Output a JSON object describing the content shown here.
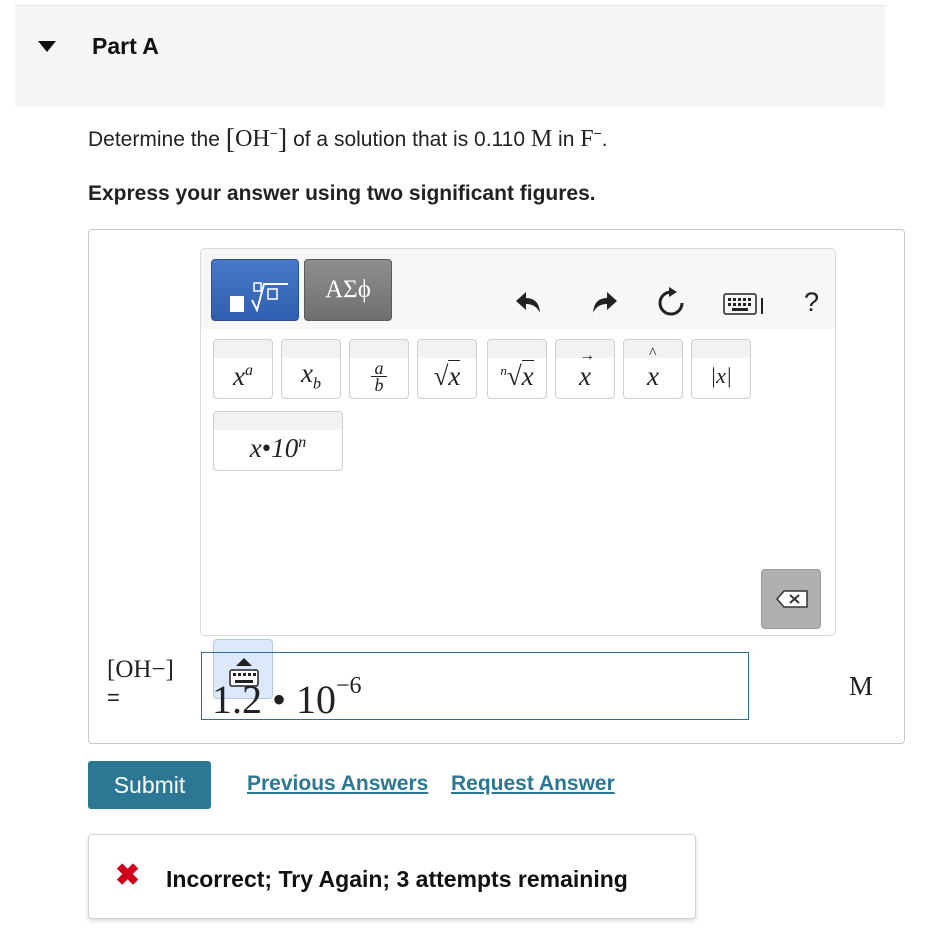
{
  "part": {
    "title": "Part A"
  },
  "question": {
    "prefix": "Determine the ",
    "species": "OH",
    "species_charge": "−",
    "middle": " of a solution that is 0.110 ",
    "unit": "M",
    "in_text": " in ",
    "solute": "F",
    "solute_charge": "−",
    "end": "."
  },
  "instruction": "Express your answer using two significant figures.",
  "editor": {
    "toolbar": {
      "templates_label": "√",
      "greek_label": "ΑΣϕ",
      "icons": [
        "undo-icon",
        "redo-icon",
        "reset-icon",
        "keyboard-icon",
        "help-icon"
      ],
      "help_label": "?"
    },
    "keys": [
      {
        "name": "superscript",
        "label": "xa"
      },
      {
        "name": "subscript",
        "label": "xb"
      },
      {
        "name": "fraction",
        "label": "a/b"
      },
      {
        "name": "sqrt",
        "label": "√x"
      },
      {
        "name": "nth-root",
        "label": "n√x"
      },
      {
        "name": "vector",
        "label": "x⃗"
      },
      {
        "name": "unit-vector",
        "label": "x̂"
      },
      {
        "name": "abs",
        "label": "|x|"
      },
      {
        "name": "sci-notation",
        "label": "x•10n"
      }
    ]
  },
  "answer": {
    "label": "[OH−]",
    "equals": "=",
    "mantissa": "1.2 • 10",
    "exponent": "−6",
    "unit": "M"
  },
  "actions": {
    "submit": "Submit",
    "previous_answers": "Previous Answers",
    "request_answer": "Request Answer"
  },
  "feedback": {
    "text": "Incorrect; Try Again; 3 attempts remaining",
    "status_color": "#d0021b"
  },
  "colors": {
    "accent": "#2c7794",
    "template_button": "#3b6cc0"
  }
}
